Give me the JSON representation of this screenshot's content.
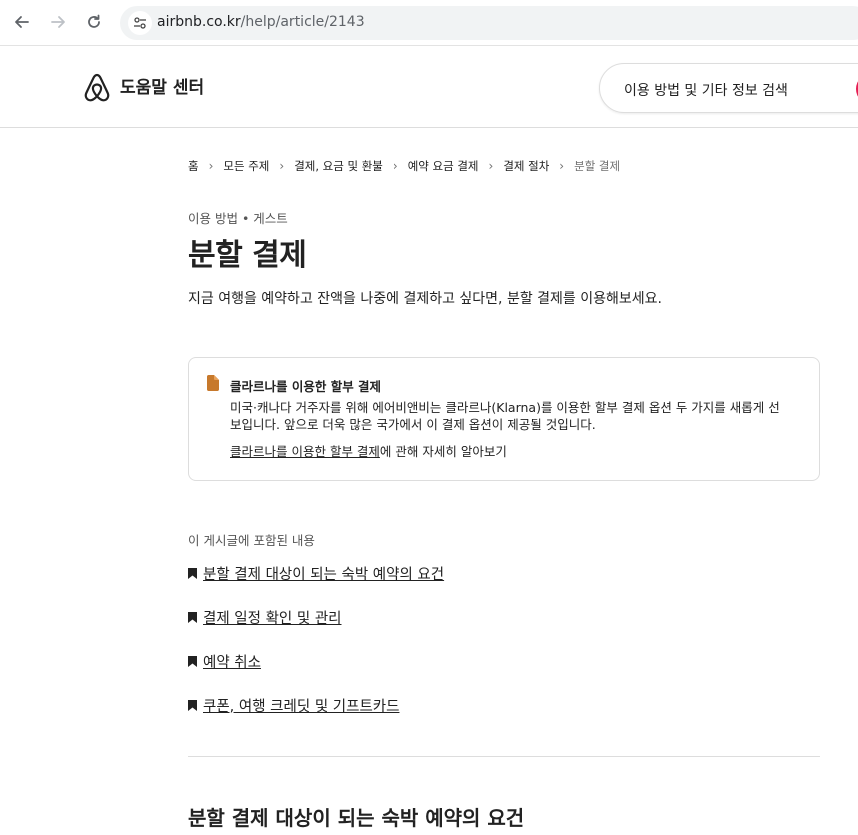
{
  "browser": {
    "url_host": "airbnb.co.kr",
    "url_path": "/help/article/2143"
  },
  "header": {
    "brand": "도움말 센터",
    "search_placeholder": "이용 방법 및 기타 정보 검색",
    "accent_color": "#e51d53"
  },
  "breadcrumb": [
    {
      "label": "홈"
    },
    {
      "label": "모든 주제"
    },
    {
      "label": "결제, 요금 및 환불"
    },
    {
      "label": "예약 요금 결제"
    },
    {
      "label": "결제 절차"
    },
    {
      "label": "분할 결제"
    }
  ],
  "article": {
    "category": "이용 방법 • 게스트",
    "title": "분할 결제",
    "lead": "지금 여행을 예약하고 잔액을 나중에 결제하고 싶다면, 분할 결제를 이용해보세요.",
    "notice": {
      "icon": "document-icon",
      "title": "클라르나를 이용한 할부 결제",
      "body": "미국·캐나다 거주자를 위해 에어비앤비는 클라르나(Klarna)를 이용한 할부 결제 옵션 두 가지를 새롭게 선보입니다. 앞으로 더욱 많은 국가에서 이 결제 옵션이 제공될 것입니다.",
      "link_label": "클라르나를 이용한 할부 결제",
      "link_suffix": "에 관해 자세히 알아보기"
    },
    "toc_heading": "이 게시글에 포함된 내용",
    "toc": [
      {
        "label": "분할 결제 대상이 되는 숙박 예약의 요건"
      },
      {
        "label": "결제 일정 확인 및 관리"
      },
      {
        "label": "예약 취소"
      },
      {
        "label": "쿠폰, 여행 크레딧 및 기프트카드"
      }
    ],
    "section_title": "분할 결제 대상이 되는 숙박 예약의 요건"
  }
}
